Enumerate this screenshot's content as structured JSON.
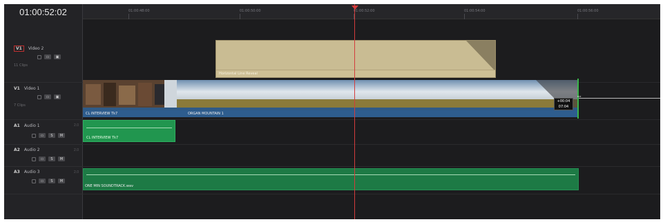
{
  "timecode": "01:00:52:02",
  "ruler": {
    "ticks": [
      "01:00:48:00",
      "01:00:50:00",
      "01:00:52:00",
      "01:00:54:00",
      "01:00:56:00"
    ]
  },
  "tracks": {
    "v2": {
      "badge": "V1",
      "name": "Video 2",
      "clips": "11 Clips"
    },
    "v1": {
      "badge": "V1",
      "name": "Video 1",
      "clips": "7 Clips"
    },
    "a1": {
      "badge": "A1",
      "name": "Audio 1",
      "num": "2.0",
      "s": "S",
      "m": "M"
    },
    "a2": {
      "badge": "A2",
      "name": "Audio 2",
      "num": "2.0",
      "s": "S",
      "m": "M"
    },
    "a3": {
      "badge": "A3",
      "name": "Audio 3",
      "num": "2.0",
      "s": "S",
      "m": "M"
    }
  },
  "clips": {
    "generator": "Horizontal Line Reveal",
    "video_a": "CL INTERVIEW Tk7",
    "video_b": "ORGAN MOUNTAIN 1",
    "audio_a": "CL INTERVIEW Tk7",
    "audio_b": "ONE MIN SOUNDTRACK.wav"
  },
  "trim_tooltip": {
    "delta": "+00:04",
    "duration": "07:04"
  },
  "colors": {
    "playhead": "#d43c3c",
    "audio": "#21964f",
    "video": "#2f5a86",
    "generator": "#c9bc93"
  }
}
